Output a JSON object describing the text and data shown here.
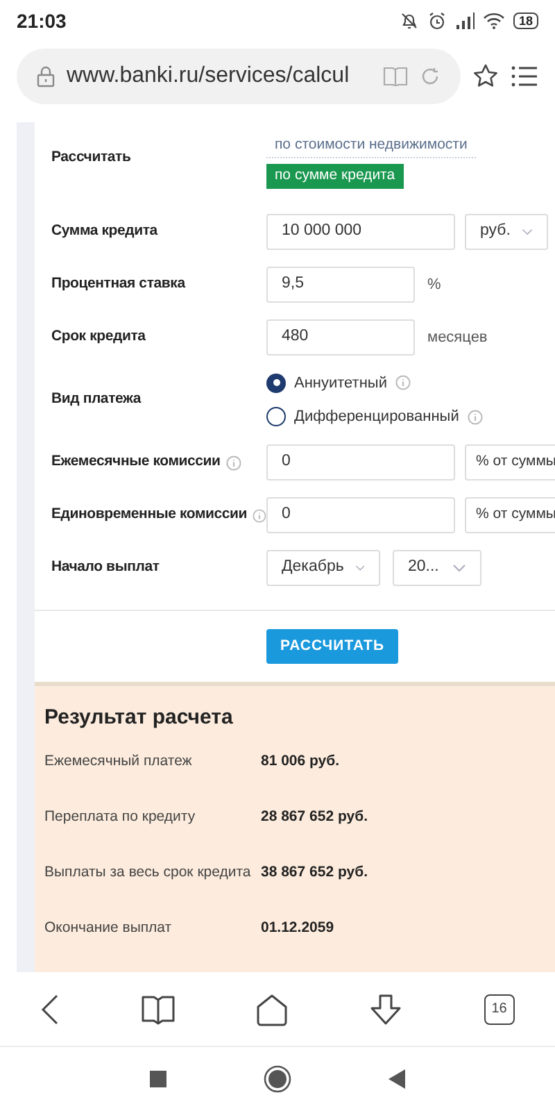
{
  "status_bar": {
    "time": "21:03",
    "battery": "18"
  },
  "address_bar": {
    "url": "www.banki.ru/services/calcul"
  },
  "form": {
    "rows": [
      {
        "kind": "options",
        "label": "Рассчитать",
        "options": [
          {
            "label": "по стоимости недвижимости",
            "selected": false
          },
          {
            "label": "по сумме кредита",
            "selected": true
          }
        ]
      },
      {
        "kind": "input",
        "label": "Сумма кредита",
        "value": "10 000 000",
        "select": {
          "value": "руб.",
          "chevron": true
        }
      },
      {
        "kind": "input",
        "label": "Процентная ставка",
        "value": "9,5",
        "unit": "%"
      },
      {
        "kind": "input",
        "label": "Срок кредита",
        "value": "480",
        "unit": "месяцев"
      },
      {
        "kind": "radio",
        "label": "Вид платежа",
        "options": [
          {
            "label": "Аннуитетный",
            "selected": true,
            "info": true
          },
          {
            "label": "Дифференцированный",
            "selected": false,
            "info": true
          }
        ]
      },
      {
        "kind": "input",
        "label": "Ежемесячные комиссии",
        "info": true,
        "value": "0",
        "select": {
          "value": "% от суммы",
          "chevron": false
        }
      },
      {
        "kind": "input",
        "label": "Единовременные комиссии",
        "info": true,
        "value": "0",
        "select": {
          "value": "% от суммы",
          "chevron": false
        }
      },
      {
        "kind": "dates",
        "label": "Начало выплат",
        "selects": [
          "Декабрь",
          "20..."
        ]
      }
    ],
    "submit": "РАССЧИТАТЬ"
  },
  "result": {
    "title": "Результат расчета",
    "rows": [
      {
        "label": "Ежемесячный платеж",
        "value": "81 006 руб."
      },
      {
        "label": "Переплата по кредиту",
        "value": "28 867 652 руб."
      },
      {
        "label": "Выплаты за весь срок кредита",
        "value": "38 867 652 руб."
      },
      {
        "label": "Окончание выплат",
        "value": "01.12.2059"
      }
    ]
  },
  "browser_toolbar": {
    "tabs_count": "16"
  }
}
